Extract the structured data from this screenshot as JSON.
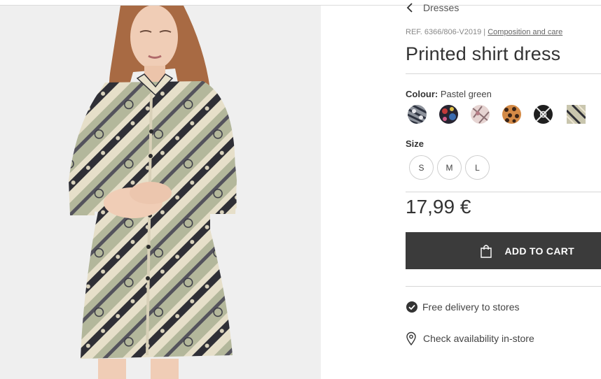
{
  "product": {
    "breadcrumb": "Dresses",
    "ref_text": "REF. 6366/806-V2019 | ",
    "composition_link": "Composition and care",
    "title": "Printed shirt dress",
    "colour_heading": "Colour:",
    "colour_value": " Pastel green",
    "colour_swatches": [
      {
        "name": "swatch-grey-print",
        "color": "#6f7480"
      },
      {
        "name": "swatch-floral-dark",
        "color": "#3a2a35"
      },
      {
        "name": "swatch-pink-print",
        "color": "#d8c2c4"
      },
      {
        "name": "swatch-leopard",
        "color": "#c97a3a"
      },
      {
        "name": "swatch-black-white-print",
        "color": "#2b2b2b"
      },
      {
        "name": "swatch-pastel-green-selected",
        "color": "#b9b59e"
      }
    ],
    "size_heading": "Size",
    "sizes": [
      "S",
      "M",
      "L"
    ],
    "price": "17,99 €",
    "add_to_cart": "ADD TO CART",
    "delivery_text": "Free delivery to stores",
    "availability_text": "Check availability in-store"
  },
  "colors": {
    "cart_button": "#3b3b3b",
    "photo_background": "#efefef",
    "dress_base": "#a9ae93"
  },
  "icons": {
    "back": "chevron-left-icon",
    "bag": "shopping-bag-icon",
    "delivery": "check-circle-icon",
    "store": "location-pin-icon"
  }
}
